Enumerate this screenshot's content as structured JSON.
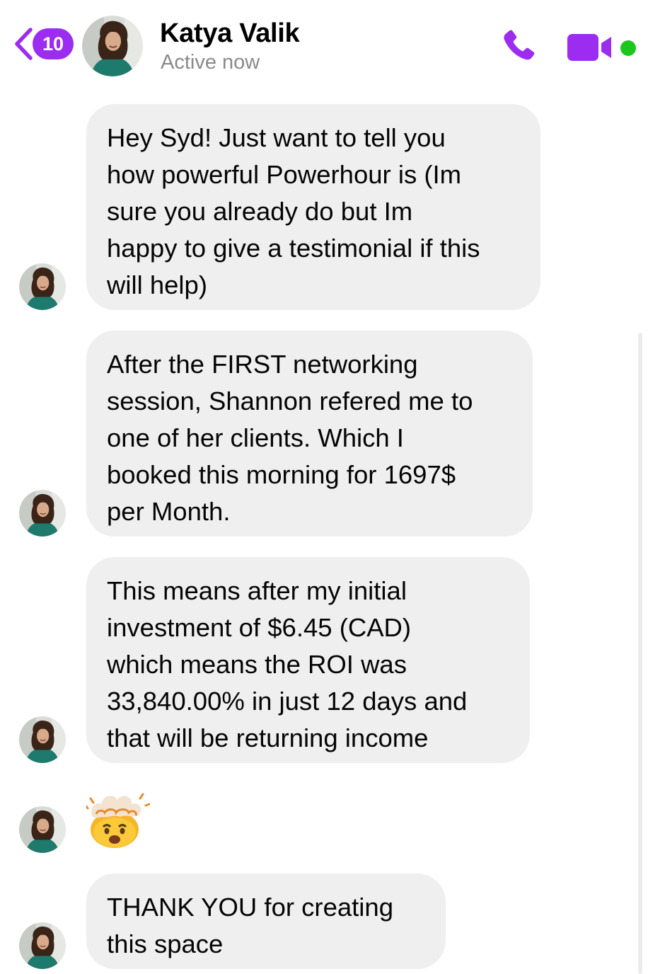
{
  "header": {
    "back_badge": "10",
    "contact_name": "Katya Valik",
    "status": "Active now"
  },
  "colors": {
    "accent": "#9b2cf0",
    "online": "#1cc71c",
    "bubble": "#efeff0",
    "status_text": "#8a8a8a"
  },
  "icons": [
    "back-chevron-icon",
    "phone-icon",
    "video-camera-icon"
  ],
  "messages": [
    {
      "lines": [
        "Hey Syd! Just want to tell you",
        "how powerful Powerhour is (Im",
        "sure you already do but Im",
        "happy to give a testimonial if this",
        "will help)"
      ]
    },
    {
      "lines": [
        "After the FIRST networking",
        "session, Shannon refered me to",
        "one of her clients. Which I",
        "booked this morning for 1697$",
        "per Month."
      ]
    },
    {
      "lines": [
        "This means after my initial",
        "investment of $6.45 (CAD)",
        "which means the ROI was",
        "33,840.00% in just 12 days and",
        "that will be returning income"
      ]
    },
    {
      "emoji": "exploding-head-emoji"
    },
    {
      "lines": [
        "THANK YOU for creating",
        "this space"
      ]
    }
  ]
}
